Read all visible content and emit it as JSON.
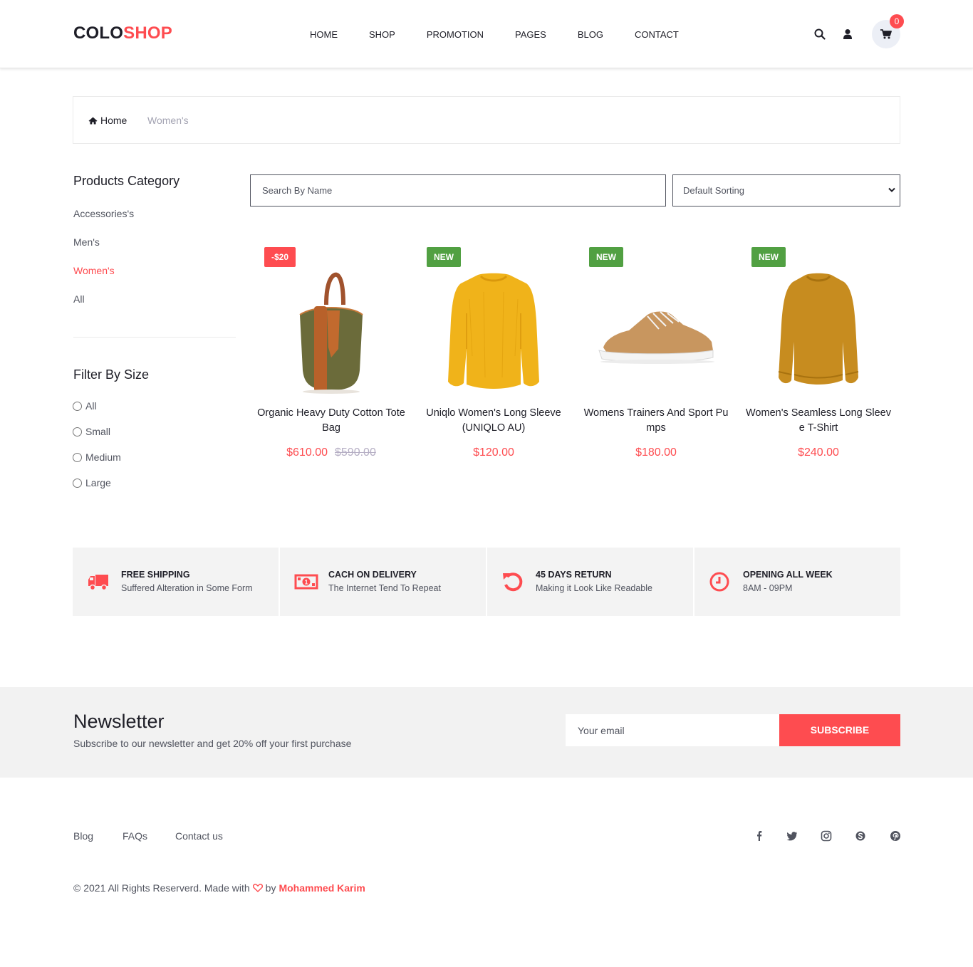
{
  "header": {
    "logo_part1": "COLO",
    "logo_part2": "SHOP",
    "nav": [
      "HOME",
      "SHOP",
      "PROMOTION",
      "PAGES",
      "BLOG",
      "CONTACT"
    ],
    "cart_count": "0",
    "icons": [
      "search-icon",
      "user-icon",
      "shopping-cart-icon"
    ]
  },
  "breadcrumb": {
    "home": "Home",
    "current": "Women's"
  },
  "sidebar": {
    "category_title": "Products Category",
    "categories": [
      {
        "label": "Accessories's",
        "active": false
      },
      {
        "label": "Men's",
        "active": false
      },
      {
        "label": "Women's",
        "active": true
      },
      {
        "label": "All",
        "active": false
      }
    ],
    "size_title": "Filter By Size",
    "sizes": [
      "All",
      "Small",
      "Medium",
      "Large"
    ]
  },
  "filters": {
    "search_placeholder": "Search By Name",
    "sort_selected": "Default Sorting"
  },
  "products": [
    {
      "badge": "-$20",
      "badge_type": "sale",
      "name": "Organic Heavy Duty Cotton Tote Bag",
      "price": "$610.00",
      "old_price": "$590.00",
      "image": "tote-bag"
    },
    {
      "badge": "NEW",
      "badge_type": "new",
      "name": "Uniqlo Women's Long Sleeve (UNIQLO AU)",
      "price": "$120.00",
      "old_price": "",
      "image": "yellow-sweater"
    },
    {
      "badge": "NEW",
      "badge_type": "new",
      "name": "Womens Trainers And Sport Pumps",
      "price": "$180.00",
      "old_price": "",
      "image": "tan-sneaker"
    },
    {
      "badge": "NEW",
      "badge_type": "new",
      "name": "Women's Seamless Long Sleeve T-Shirt",
      "price": "$240.00",
      "old_price": "",
      "image": "mustard-sweater"
    }
  ],
  "benefits": [
    {
      "title": "FREE SHIPPING",
      "subtitle": "Suffered Alteration in Some Form",
      "icon": "truck-icon"
    },
    {
      "title": "CACH ON DELIVERY",
      "subtitle": "The Internet Tend To Repeat",
      "icon": "money-icon"
    },
    {
      "title": "45 DAYS RETURN",
      "subtitle": "Making it Look Like Readable",
      "icon": "undo-icon"
    },
    {
      "title": "OPENING ALL WEEK",
      "subtitle": "8AM - 09PM",
      "icon": "clock-icon"
    }
  ],
  "newsletter": {
    "title": "Newsletter",
    "subtitle": "Subscribe to our newsletter and get 20% off your first purchase",
    "email_placeholder": "Your email",
    "button": "SUBSCRIBE"
  },
  "footer": {
    "links": [
      "Blog",
      "FAQs",
      "Contact us"
    ],
    "social": [
      "facebook-icon",
      "twitter-icon",
      "instagram-icon",
      "skype-icon",
      "pinterest-icon"
    ],
    "copyright_prefix": "© 2021 All Rights Reserverd. Made with",
    "copyright_by": "by",
    "author": "Mohammed Karim"
  },
  "colors": {
    "accent": "#fe4c50",
    "new_badge": "#51a042",
    "text_dark": "#1e1e27",
    "text_muted": "#51545f"
  }
}
